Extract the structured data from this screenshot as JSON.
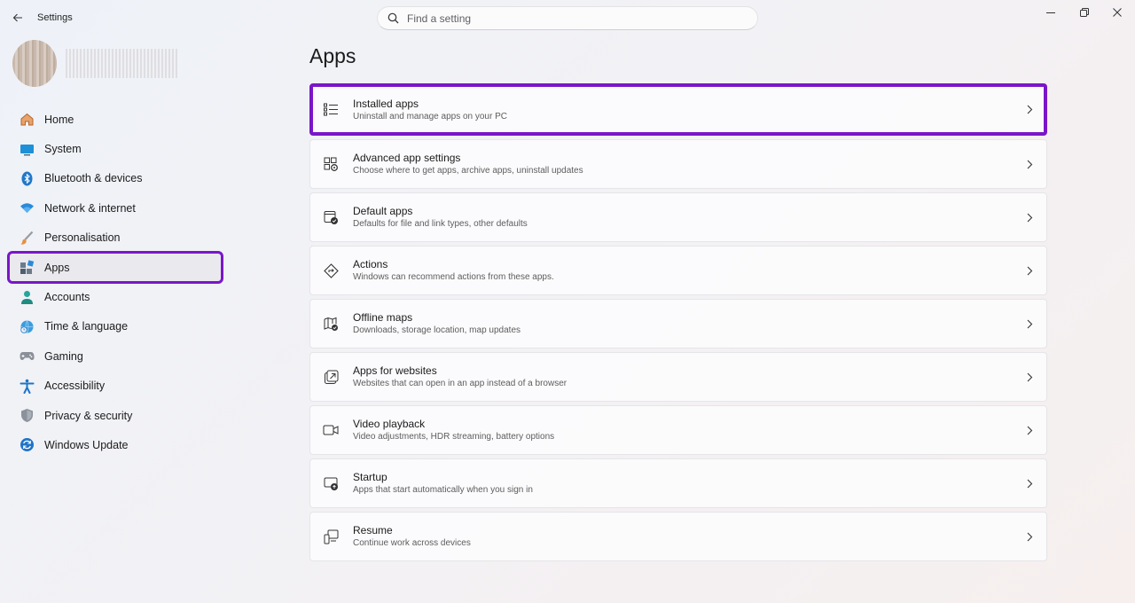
{
  "window": {
    "title": "Settings"
  },
  "search": {
    "placeholder": "Find a setting"
  },
  "sidebar": {
    "items": [
      {
        "label": "Home",
        "icon": "home-icon"
      },
      {
        "label": "System",
        "icon": "system-icon"
      },
      {
        "label": "Bluetooth & devices",
        "icon": "bluetooth-icon"
      },
      {
        "label": "Network & internet",
        "icon": "wifi-icon"
      },
      {
        "label": "Personalisation",
        "icon": "brush-icon"
      },
      {
        "label": "Apps",
        "icon": "apps-icon",
        "selected": true
      },
      {
        "label": "Accounts",
        "icon": "person-icon"
      },
      {
        "label": "Time & language",
        "icon": "globe-clock-icon"
      },
      {
        "label": "Gaming",
        "icon": "gamepad-icon"
      },
      {
        "label": "Accessibility",
        "icon": "accessibility-icon"
      },
      {
        "label": "Privacy & security",
        "icon": "shield-icon"
      },
      {
        "label": "Windows Update",
        "icon": "update-icon"
      }
    ]
  },
  "main": {
    "title": "Apps",
    "cards": [
      {
        "title": "Installed apps",
        "subtitle": "Uninstall and manage apps on your PC",
        "icon": "list-icon"
      },
      {
        "title": "Advanced app settings",
        "subtitle": "Choose where to get apps, archive apps, uninstall updates",
        "icon": "app-settings-icon"
      },
      {
        "title": "Default apps",
        "subtitle": "Defaults for file and link types, other defaults",
        "icon": "default-apps-icon"
      },
      {
        "title": "Actions",
        "subtitle": "Windows can recommend actions from these apps.",
        "icon": "actions-icon"
      },
      {
        "title": "Offline maps",
        "subtitle": "Downloads, storage location, map updates",
        "icon": "map-icon"
      },
      {
        "title": "Apps for websites",
        "subtitle": "Websites that can open in an app instead of a browser",
        "icon": "open-external-icon"
      },
      {
        "title": "Video playback",
        "subtitle": "Video adjustments, HDR streaming, battery options",
        "icon": "video-icon"
      },
      {
        "title": "Startup",
        "subtitle": "Apps that start automatically when you sign in",
        "icon": "startup-icon"
      },
      {
        "title": "Resume",
        "subtitle": "Continue work across devices",
        "icon": "resume-icon"
      }
    ]
  },
  "colors": {
    "highlight": "#7a16c8",
    "accent": "#0067c0"
  }
}
